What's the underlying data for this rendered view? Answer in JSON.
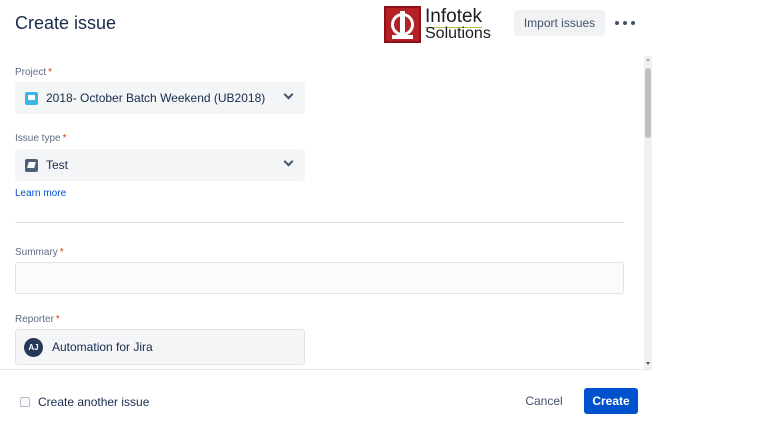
{
  "header": {
    "title": "Create issue",
    "logo_line1": "Infotek",
    "logo_line2": "Solutions",
    "import_label": "Import issues",
    "more_icon": "more-horizontal-icon"
  },
  "form": {
    "project": {
      "label": "Project",
      "required": "*",
      "value": "2018- October Batch Weekend (UB2018)",
      "icon": "project-avatar-icon"
    },
    "issue_type": {
      "label": "Issue type",
      "required": "*",
      "value": "Test",
      "icon": "test-issue-icon"
    },
    "learn_more": "Learn more",
    "summary": {
      "label": "Summary",
      "required": "*",
      "value": ""
    },
    "reporter": {
      "label": "Reporter",
      "required": "*",
      "avatar_initials": "AJ",
      "value": "Automation for Jira"
    }
  },
  "footer": {
    "create_another_label": "Create another issue",
    "create_another_checked": false,
    "cancel_label": "Cancel",
    "create_label": "Create"
  },
  "colors": {
    "primary": "#0052CC",
    "required": "#DE350B",
    "logo_red": "#b32025"
  }
}
